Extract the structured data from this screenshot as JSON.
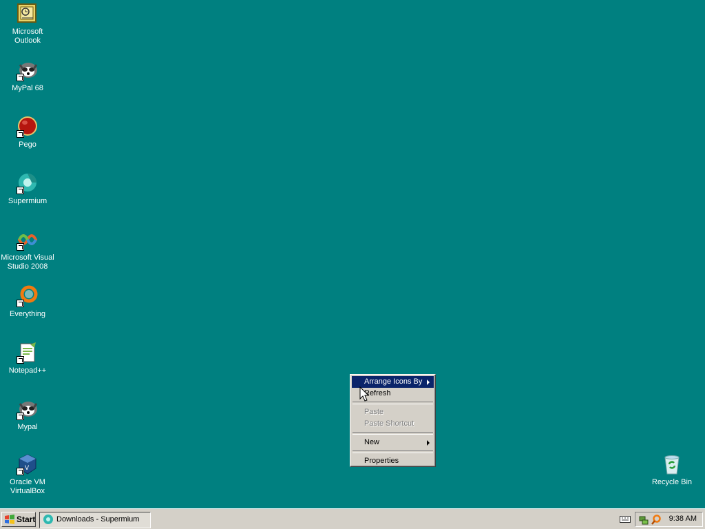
{
  "desktop": {
    "icons": [
      {
        "label": "Microsoft Outlook",
        "icon": "outlook-icon"
      },
      {
        "label": "MyPal 68",
        "icon": "mypal-icon"
      },
      {
        "label": "Pego",
        "icon": "pego-icon"
      },
      {
        "label": "Supermium",
        "icon": "supermium-icon"
      },
      {
        "label": "Microsoft Visual Studio 2008",
        "icon": "visual-studio-icon"
      },
      {
        "label": "Everything",
        "icon": "everything-icon"
      },
      {
        "label": "Notepad++",
        "icon": "notepadpp-icon"
      },
      {
        "label": "Mypal",
        "icon": "mypal-icon"
      },
      {
        "label": "Oracle VM VirtualBox",
        "icon": "virtualbox-icon"
      }
    ],
    "recycle_bin": {
      "label": "Recycle Bin",
      "icon": "recycle-bin-icon"
    },
    "background_color": "#008080"
  },
  "context_menu": {
    "items": [
      {
        "label": "Arrange Icons By",
        "submenu": true,
        "highlighted": true
      },
      {
        "label": "Refresh"
      },
      {
        "label": "Paste",
        "disabled": true
      },
      {
        "label": "Paste Shortcut",
        "disabled": true
      },
      {
        "label": "New",
        "submenu": true
      },
      {
        "label": "Properties"
      }
    ],
    "highlight_color": "#0a246a"
  },
  "taskbar": {
    "start_label": "Start",
    "task_button_label": "Downloads - Supermium",
    "clock": "9:38 AM",
    "tray_icons": [
      "keyboard-icon",
      "network-icon",
      "search-magnifier-icon"
    ]
  }
}
